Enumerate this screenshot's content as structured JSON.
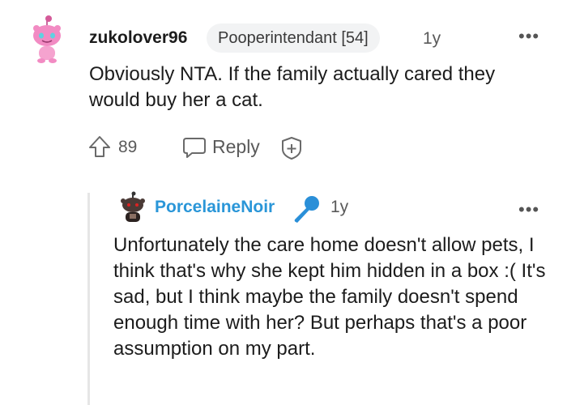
{
  "comment": {
    "username": "zukolover96",
    "flair": "Pooperintendant [54]",
    "age": "1y",
    "body": "Obviously NTA. If the family actually cared they would buy her a cat.",
    "vote_count": "89",
    "reply_label": "Reply",
    "more_label": "•••"
  },
  "reply": {
    "username": "PorcelaineNoir",
    "age": "1y",
    "body": "Unfortunately the care home doesn't allow pets, I think that's why she kept him hidden in a box :( It's sad, but I think maybe the family doesn't spend enough time with her? But perhaps that's a poor assumption on my part.",
    "more_label": "•••"
  },
  "colors": {
    "username_link": "#2a96d8",
    "avatar_pink": "#f28bc3",
    "mic_blue": "#2a8fd8"
  },
  "icons": [
    "snoo-avatar-icon",
    "upvote-arrow-icon",
    "reply-bubble-icon",
    "add-award-icon",
    "dark-avatar-icon",
    "microphone-icon",
    "more-options-icon"
  ]
}
